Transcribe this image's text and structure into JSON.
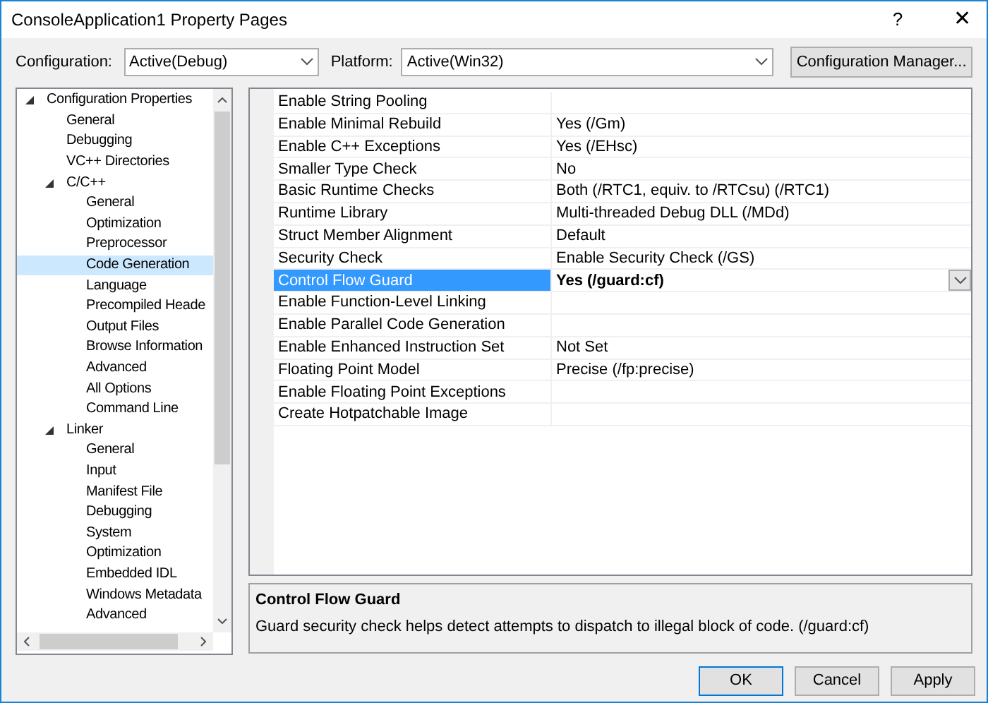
{
  "window": {
    "title": "ConsoleApplication1 Property Pages",
    "buttons": [
      "?",
      "✕"
    ]
  },
  "toolbar": {
    "configuration": {
      "label": "Configuration:",
      "value": "Active(Debug)"
    },
    "platform": {
      "label": "Platform:",
      "value": "Active(Win32)"
    },
    "manager_button": "Configuration Manager..."
  },
  "tree": [
    {
      "label": "Configuration Properties",
      "expanded": true,
      "selected": false,
      "children": [
        {
          "label": "General",
          "selected": false
        },
        {
          "label": "Debugging",
          "selected": false
        },
        {
          "label": "VC++ Directories",
          "selected": false
        },
        {
          "label": "C/C++",
          "expanded": true,
          "selected": false,
          "children": [
            {
              "label": "General",
              "selected": false
            },
            {
              "label": "Optimization",
              "selected": false
            },
            {
              "label": "Preprocessor",
              "selected": false
            },
            {
              "label": "Code Generation",
              "selected": true
            },
            {
              "label": "Language",
              "selected": false
            },
            {
              "label": "Precompiled Heade",
              "selected": false
            },
            {
              "label": "Output Files",
              "selected": false
            },
            {
              "label": "Browse Information",
              "selected": false
            },
            {
              "label": "Advanced",
              "selected": false
            },
            {
              "label": "All Options",
              "selected": false
            },
            {
              "label": "Command Line",
              "selected": false
            }
          ]
        },
        {
          "label": "Linker",
          "expanded": true,
          "selected": false,
          "children": [
            {
              "label": "General",
              "selected": false
            },
            {
              "label": "Input",
              "selected": false
            },
            {
              "label": "Manifest File",
              "selected": false
            },
            {
              "label": "Debugging",
              "selected": false
            },
            {
              "label": "System",
              "selected": false
            },
            {
              "label": "Optimization",
              "selected": false
            },
            {
              "label": "Embedded IDL",
              "selected": false
            },
            {
              "label": "Windows Metadata",
              "selected": false
            },
            {
              "label": "Advanced",
              "selected": false
            }
          ]
        }
      ]
    }
  ],
  "properties": [
    {
      "name": "Enable String Pooling",
      "selected": false
    },
    {
      "name": "Enable Minimal Rebuild",
      "value": "Yes (/Gm)",
      "selected": false
    },
    {
      "name": "Enable C++ Exceptions",
      "value": "Yes (/EHsc)",
      "selected": false
    },
    {
      "name": "Smaller Type Check",
      "value": "No",
      "selected": false
    },
    {
      "name": "Basic Runtime Checks",
      "value": "Both (/RTC1, equiv. to /RTCsu) (/RTC1)",
      "selected": false
    },
    {
      "name": "Runtime Library",
      "value": "Multi-threaded Debug DLL (/MDd)",
      "selected": false
    },
    {
      "name": "Struct Member Alignment",
      "value": "Default",
      "selected": false
    },
    {
      "name": "Security Check",
      "value": "Enable Security Check (/GS)",
      "selected": false
    },
    {
      "name": "Control Flow Guard",
      "value": "Yes (/guard:cf)",
      "selected": true
    },
    {
      "name": "Enable Function-Level Linking",
      "selected": false
    },
    {
      "name": "Enable Parallel Code Generation",
      "selected": false
    },
    {
      "name": "Enable Enhanced Instruction Set",
      "value": "Not Set",
      "selected": false
    },
    {
      "name": "Floating Point Model",
      "value": "Precise (/fp:precise)",
      "selected": false
    },
    {
      "name": "Enable Floating Point Exceptions",
      "selected": false
    },
    {
      "name": "Create Hotpatchable Image",
      "selected": false
    }
  ],
  "description": {
    "title": "Control Flow Guard",
    "text": "Guard security check helps detect attempts to dispatch to illegal block of code. (/guard:cf)"
  },
  "buttons": [
    "OK",
    "Cancel",
    "Apply"
  ]
}
